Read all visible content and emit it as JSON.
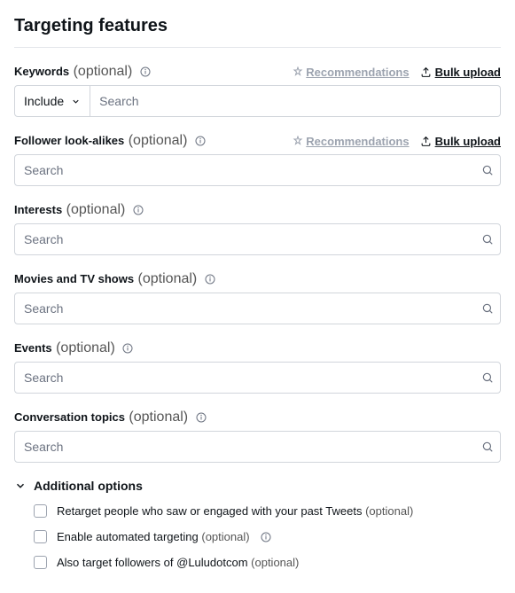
{
  "title": "Targeting features",
  "common": {
    "optional": "(optional)",
    "search_placeholder": "Search",
    "recommendations": "Recommendations",
    "bulk_upload": "Bulk upload"
  },
  "include": {
    "label": "Include"
  },
  "fields": {
    "keywords": {
      "label": "Keywords"
    },
    "lookalikes": {
      "label": "Follower look-alikes"
    },
    "interests": {
      "label": "Interests"
    },
    "movies": {
      "label": "Movies and TV shows"
    },
    "events": {
      "label": "Events"
    },
    "conversation": {
      "label": "Conversation topics"
    }
  },
  "additional": {
    "header": "Additional options",
    "opt1": "Retarget people who saw or engaged with your past Tweets",
    "opt2": "Enable automated targeting",
    "opt3": "Also target followers of @Luludotcom"
  }
}
